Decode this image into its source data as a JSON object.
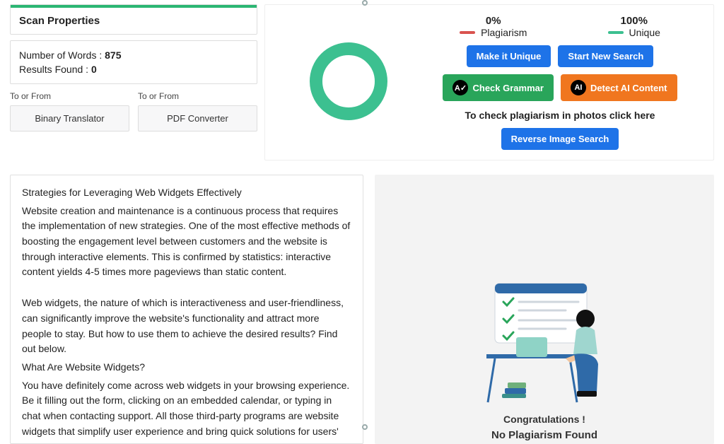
{
  "scan": {
    "title": "Scan Properties",
    "words_label": "Number of Words :",
    "words_value": "875",
    "results_label": "Results Found :",
    "results_value": "0"
  },
  "tools": [
    {
      "hint": "To or From",
      "name": "Binary Translator"
    },
    {
      "hint": "To or From",
      "name": "PDF Converter"
    }
  ],
  "percent": {
    "plag_val": "0%",
    "plag_lbl": "Plagiarism",
    "uniq_val": "100%",
    "uniq_lbl": "Unique"
  },
  "actions": {
    "make_unique": "Make it Unique",
    "start_new": "Start New Search",
    "check_grammar": "Check Grammar",
    "detect_ai": "Detect AI Content",
    "reverse_image": "Reverse Image Search",
    "photo_hint": "To check plagiarism in photos click here"
  },
  "icon_labels": {
    "grammar": "A✓",
    "ai": "AI"
  },
  "article": {
    "heading": "Strategies for Leveraging Web Widgets Effectively",
    "p1": "Website creation and maintenance is a continuous process that requires the implementation of new strategies. One of the most effective methods of boosting the engagement level between customers and the website is through interactive elements. This is confirmed by statistics: interactive content yields 4-5 times more pageviews than static content.",
    "p2": "Web widgets, the nature of which is interactiveness and user-friendliness, can significantly improve the website's functionality and attract more people to stay. But how to use them to achieve the desired results? Find out below.",
    "h2": "What Are Website Widgets?",
    "p3": "You have definitely come across web widgets in your browsing experience. Be it filling out the form, clicking on an embedded calendar, or typing in chat when contacting support. All those third-party programs are website widgets that simplify user experience and bring quick solutions for users'"
  },
  "result": {
    "congrats": "Congratulations !",
    "no_plag": "No Plagiarism Found"
  }
}
